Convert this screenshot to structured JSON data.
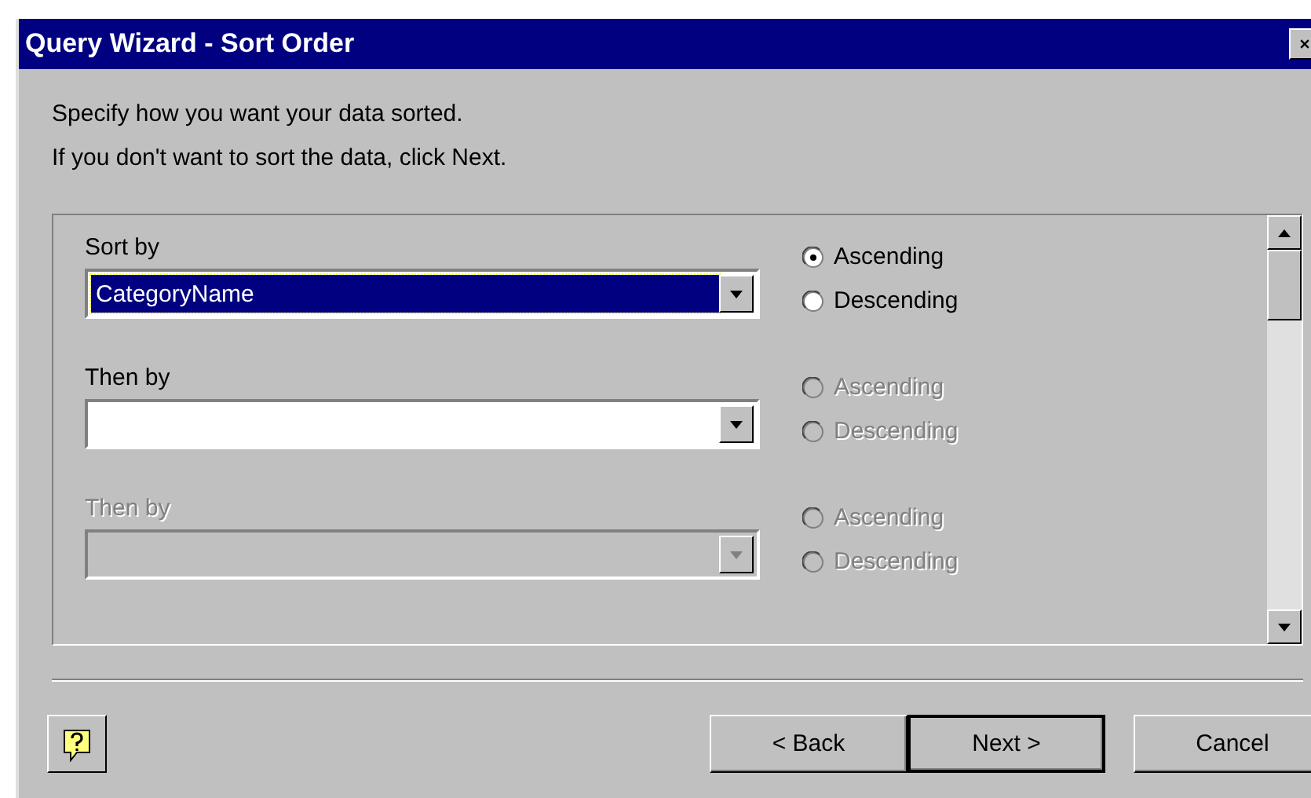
{
  "window": {
    "title": "Query Wizard - Sort Order"
  },
  "instructions": [
    "Specify how you want your data sorted.",
    "If you don't want to sort the data, click Next."
  ],
  "sort_rows": [
    {
      "label": "Sort by",
      "disabled": false,
      "combo": {
        "value": "CategoryName",
        "focused": true,
        "disabled": false
      },
      "options": [
        {
          "label": "Ascending",
          "selected": true,
          "disabled": false
        },
        {
          "label": "Descending",
          "selected": false,
          "disabled": false
        }
      ]
    },
    {
      "label": "Then by",
      "disabled": false,
      "combo": {
        "focused": false,
        "disabled": false
      },
      "options": [
        {
          "label": "Ascending",
          "selected": false,
          "disabled": true
        },
        {
          "label": "Descending",
          "selected": false,
          "disabled": true
        }
      ]
    },
    {
      "label": "Then by",
      "disabled": true,
      "combo": {
        "focused": false,
        "disabled": true
      },
      "options": [
        {
          "label": "Ascending",
          "selected": false,
          "disabled": true
        },
        {
          "label": "Descending",
          "selected": false,
          "disabled": true
        }
      ]
    }
  ],
  "buttons": [
    {
      "label": "< Back",
      "default": false
    },
    {
      "label": "Next >",
      "default": true
    },
    {
      "label": "Cancel",
      "default": false
    }
  ]
}
